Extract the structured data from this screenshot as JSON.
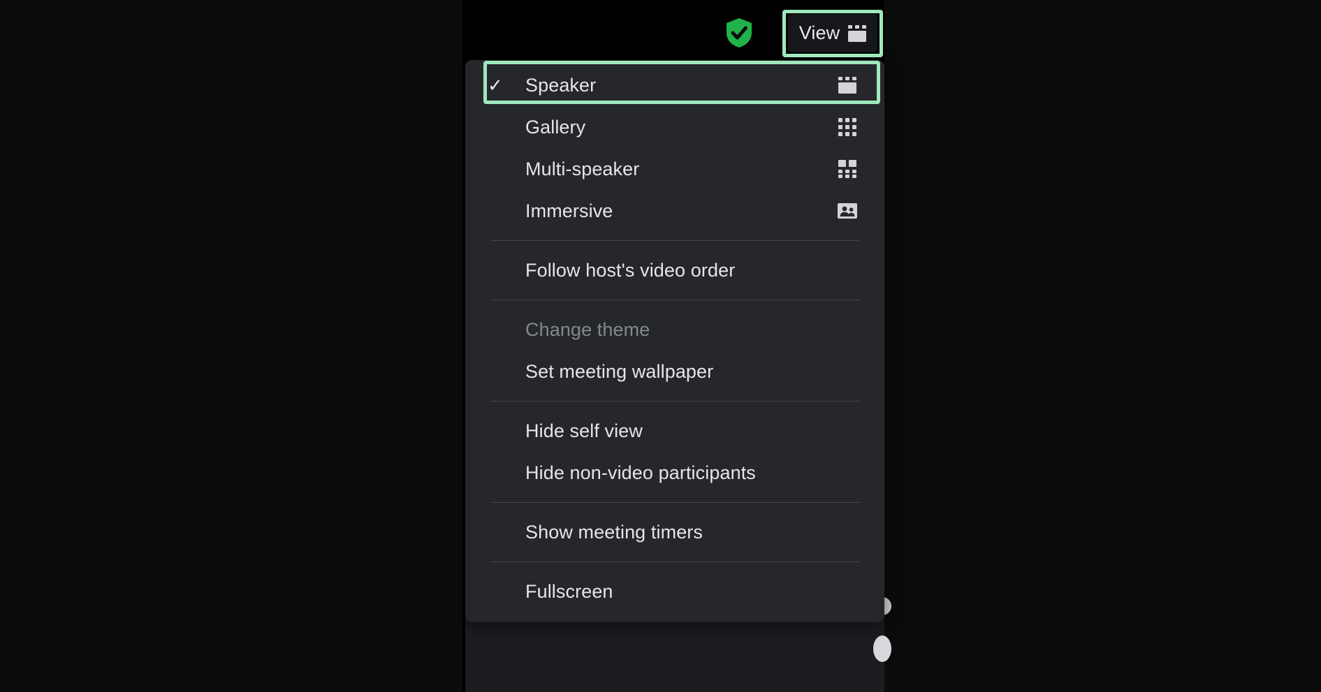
{
  "colors": {
    "menu_background": "#26272b",
    "annotation_green": "#9fe8bd",
    "shield_green": "#21b24b",
    "text_primary": "#e4e6e8",
    "text_disabled": "#838890",
    "separator": "#45474c",
    "panel_background": "#1c1d21"
  },
  "topbar": {
    "encryption_shield": {
      "icon": "shield-check-icon",
      "label": ""
    },
    "view_button": {
      "label": "View",
      "icon": "speaker-view-icon"
    }
  },
  "view_menu": {
    "groups": [
      {
        "items": [
          {
            "label": "Speaker",
            "icon": "speaker-view-icon",
            "checked": true,
            "disabled": false,
            "highlighted": true
          },
          {
            "label": "Gallery",
            "icon": "gallery-grid-icon",
            "checked": false,
            "disabled": false,
            "highlighted": false
          },
          {
            "label": "Multi-speaker",
            "icon": "multi-speaker-icon",
            "checked": false,
            "disabled": false,
            "highlighted": false
          },
          {
            "label": "Immersive",
            "icon": "immersive-people-icon",
            "checked": false,
            "disabled": false,
            "highlighted": false
          }
        ]
      },
      {
        "items": [
          {
            "label": "Follow host's video order",
            "icon": "",
            "checked": false,
            "disabled": false,
            "highlighted": false
          }
        ]
      },
      {
        "items": [
          {
            "label": "Change theme",
            "icon": "",
            "checked": false,
            "disabled": true,
            "highlighted": false
          },
          {
            "label": "Set meeting wallpaper",
            "icon": "",
            "checked": false,
            "disabled": false,
            "highlighted": false
          }
        ]
      },
      {
        "items": [
          {
            "label": "Hide self view",
            "icon": "",
            "checked": false,
            "disabled": false,
            "highlighted": false
          },
          {
            "label": "Hide non-video participants",
            "icon": "",
            "checked": false,
            "disabled": false,
            "highlighted": false
          }
        ]
      },
      {
        "items": [
          {
            "label": "Show meeting timers",
            "icon": "",
            "checked": false,
            "disabled": false,
            "highlighted": false
          }
        ]
      },
      {
        "items": [
          {
            "label": "Fullscreen",
            "icon": "",
            "checked": false,
            "disabled": false,
            "highlighted": false
          }
        ]
      }
    ],
    "checkmark_glyph": "✓"
  },
  "annotations": [
    {
      "target": "view-button",
      "color": "#9fe8bd"
    },
    {
      "target": "menu-item-speaker",
      "color": "#9fe8bd"
    }
  ]
}
